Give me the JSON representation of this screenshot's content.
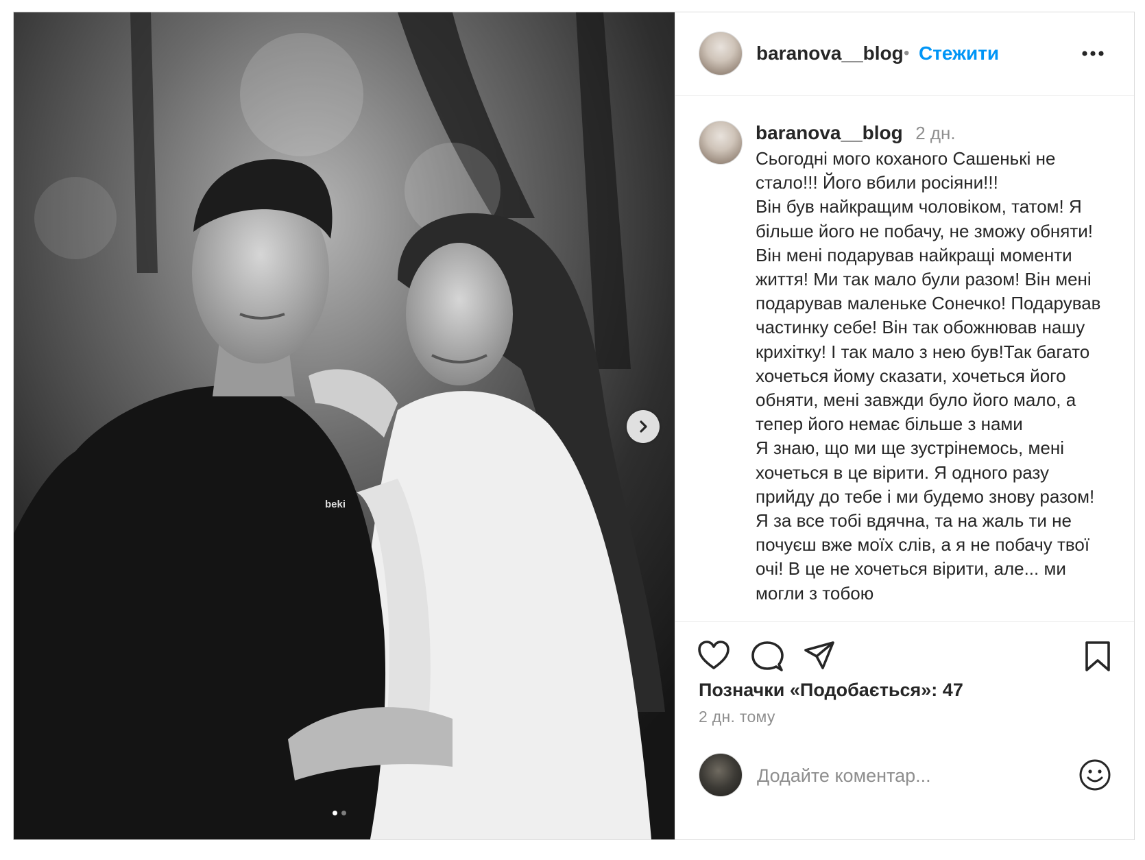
{
  "header": {
    "username": "baranova__blog",
    "separator": "•",
    "follow_label": "Стежити"
  },
  "caption": {
    "username": "baranova__blog",
    "time": "2 дн.",
    "text": "Сьогодні мого коханого Сашенькі не стало!!! Його вбили росіяни!!!\nВін був найкращим чоловіком, татом! Я більше його не побачу, не зможу обняти! Він мені подарував найкращі моменти життя! Ми так мало були разом! Він мені подарував маленьке Сонечко! Подарував частинку себе! Він так обожнював нашу крихітку! І так мало з нею був!Так багато хочеться йому сказати, хочеться його обняти, мені завжди було його мало, а тепер його немає більше з нами\nЯ знаю, що ми ще зустрінемось, мені хочеться в це вірити. Я одного разу прийду до тебе і ми будемо знову разом! Я за все тобі вдячна, та на жаль ти не почуєш вже моїх слів, а я не побачу твої очі! В це не хочеться вірити, але... ми могли з тобою"
  },
  "media": {
    "shirt_text": "beki",
    "carousel_count": 2,
    "carousel_active": 0
  },
  "actions": {
    "likes_text": "Позначки «Подобається»: 47",
    "time_ago": "2 дн. тому"
  },
  "comment": {
    "placeholder": "Додайте коментар..."
  },
  "colors": {
    "accent": "#0095f6",
    "text": "#262626",
    "muted": "#8e8e8e",
    "border": "#dbdbdb"
  },
  "icons": [
    "more-icon",
    "chevron-right-icon",
    "heart-icon",
    "comment-icon",
    "share-icon",
    "bookmark-icon",
    "emoji-icon"
  ]
}
